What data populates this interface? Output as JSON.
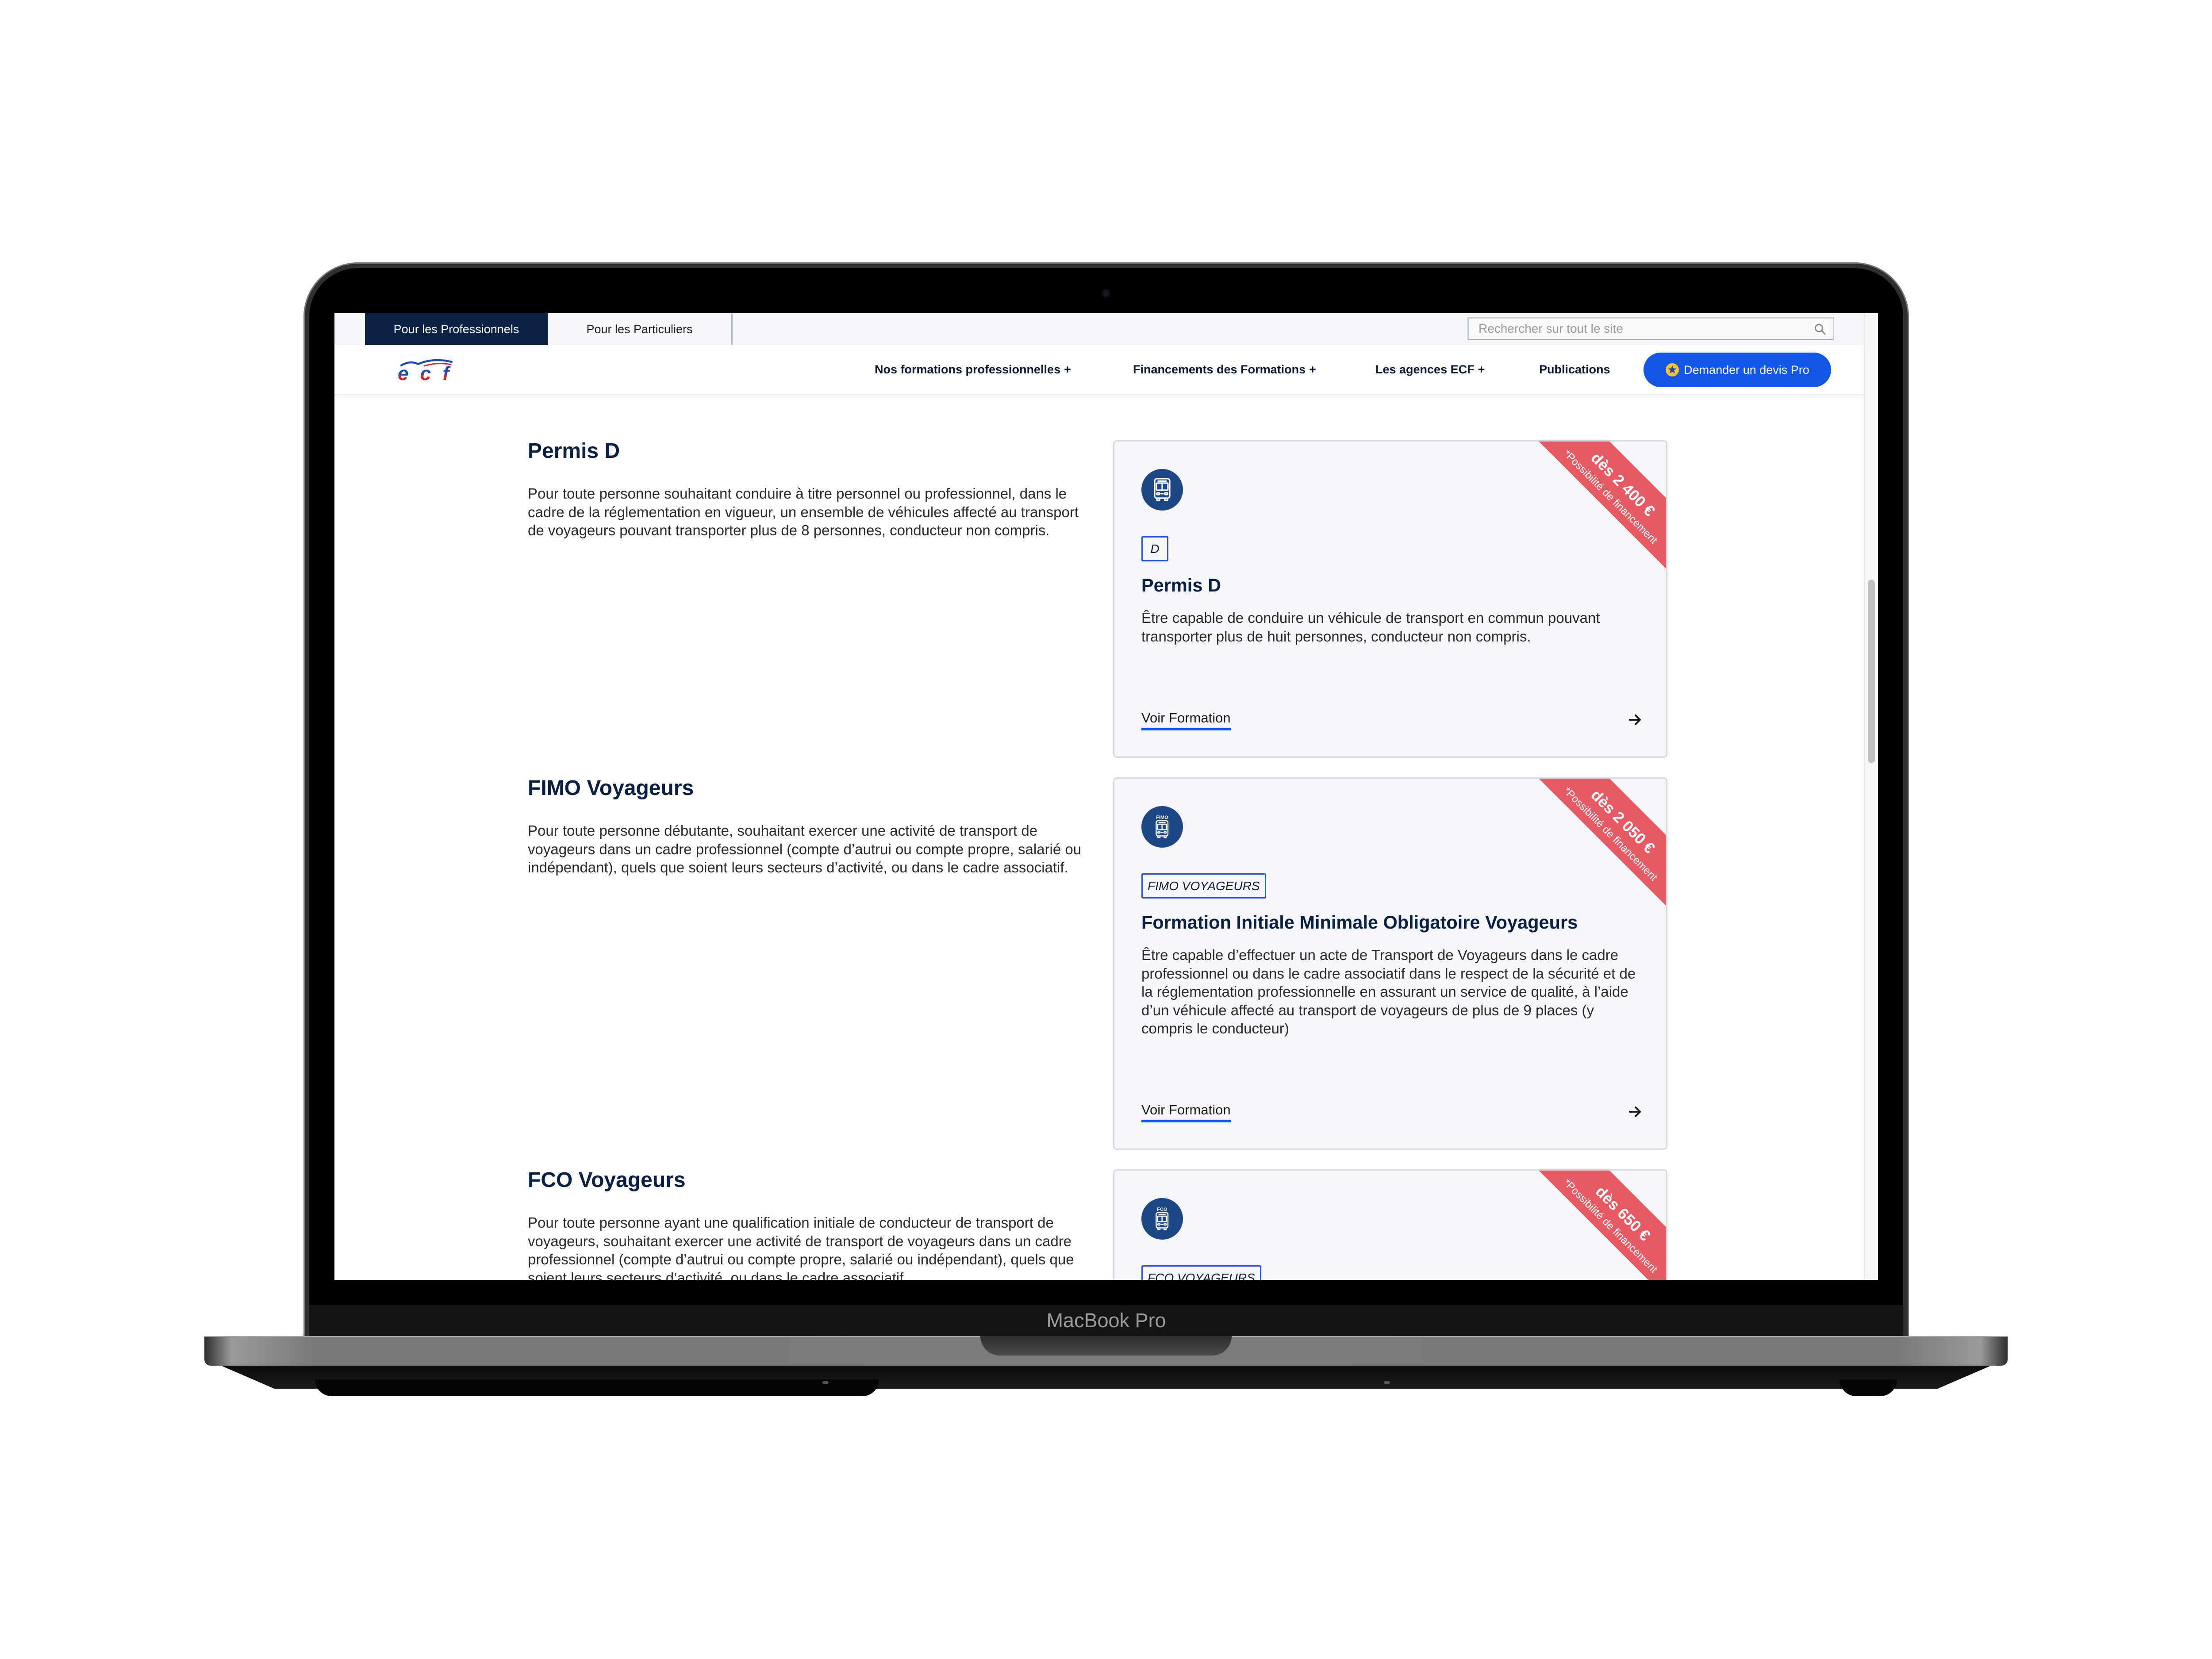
{
  "device": {
    "name": "MacBook Pro"
  },
  "colors": {
    "navy": "#0c2348",
    "accent_blue": "#1256e6",
    "ribbon_red": "#e55a63",
    "icon_blue": "#1d4685",
    "card_bg": "#f4f6f9"
  },
  "header": {
    "audience_tabs": [
      {
        "label": "Pour les Professionnels",
        "active": true
      },
      {
        "label": "Pour les Particuliers",
        "active": false
      }
    ],
    "search": {
      "placeholder": "Rechercher sur tout le site",
      "value": "",
      "icon": "search-icon"
    },
    "logo": {
      "text": "ecf"
    },
    "nav": [
      {
        "label": "Nos formations professionnelles",
        "toggle": "+"
      },
      {
        "label": "Financements des Formations",
        "toggle": "+"
      },
      {
        "label": "Les agences ECF",
        "toggle": "+"
      },
      {
        "label": "Publications"
      }
    ],
    "cta": {
      "label": "Demander un devis Pro",
      "icon": "star-icon"
    }
  },
  "sections": [
    {
      "title": "Permis D",
      "description": "Pour toute personne souhaitant conduire à titre personnel ou professionnel, dans le cadre de la réglementation en vigueur, un ensemble de véhicules affecté au transport de voyageurs pouvant transporter plus de 8 personnes, conducteur non compris.",
      "card": {
        "icon": "bus-icon",
        "icon_label": "",
        "tag": "D",
        "title": "Permis D",
        "description": "Être capable de conduire un véhicule de transport en commun pouvant transporter plus de huit personnes, conducteur non compris.",
        "link": "Voir Formation",
        "ribbon": {
          "price": "dès 2 400 €",
          "note": "*Possibilité de financement"
        }
      }
    },
    {
      "title": "FIMO Voyageurs",
      "description": "Pour toute personne débutante, souhaitant exercer une activité de transport de voyageurs dans un cadre professionnel (compte d’autrui ou compte propre, salarié ou indépendant), quels que soient leurs secteurs d’activité, ou dans le cadre associatif.",
      "card": {
        "icon": "bus-icon",
        "icon_label": "FIMO",
        "tag": "FIMO VOYAGEURS",
        "title": "Formation Initiale Minimale Obligatoire Voyageurs",
        "description": "Être capable d’effectuer un acte de Transport de Voyageurs dans le cadre professionnel ou dans le cadre associatif dans le respect de la sécurité et de la réglementation professionnelle en assurant un service de qualité, à l’aide d’un véhicule affecté au transport de voyageurs de plus de 9 places (y compris le conducteur)",
        "link": "Voir Formation",
        "ribbon": {
          "price": "dès 2 050 €",
          "note": "*Possibilité de financement"
        }
      }
    },
    {
      "title": "FCO Voyageurs",
      "description": "Pour toute personne ayant une qualification initiale de conducteur de transport de voyageurs, souhaitant exercer une activité de transport de voyageurs dans un cadre professionnel (compte d’autrui ou compte propre, salarié ou indépendant), quels que soient leurs secteurs d’activité, ou dans le cadre associatif",
      "card": {
        "icon": "bus-icon",
        "icon_label": "FCO",
        "tag": "FCO VOYAGEURS",
        "ribbon": {
          "price": "dès 650 €",
          "note": "*Possibilité de financement"
        }
      }
    }
  ],
  "scrollbar": {
    "scroll_position_pct": 34,
    "visible_fraction_pct": 19
  }
}
